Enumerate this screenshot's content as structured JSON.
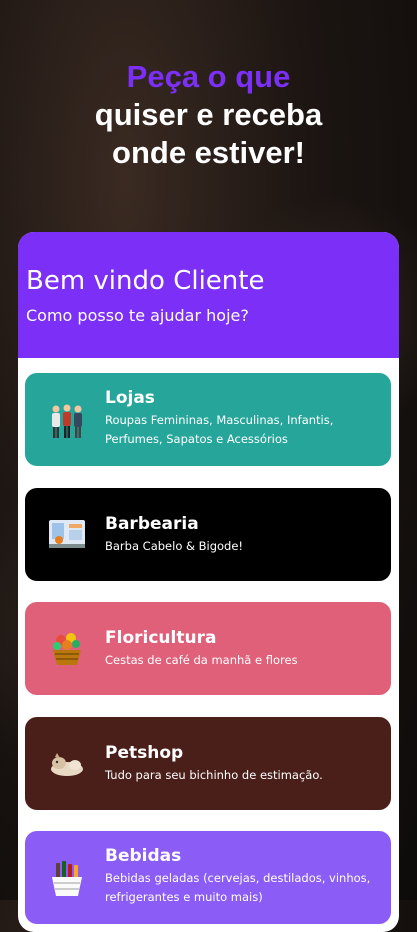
{
  "headline": {
    "accent": "Peça o que",
    "line2": "quiser e receba",
    "line3": "onde estiver!"
  },
  "header": {
    "title": "Bem vindo Cliente",
    "subtitle": "Como posso te ajudar hoje?"
  },
  "categories": [
    {
      "name": "Lojas",
      "desc": "Roupas Femininas, Masculinas, Infantis, Perfumes, Sapatos e Acessórios",
      "color": "#26a69a",
      "icon": "people-shopping-icon"
    },
    {
      "name": "Barbearia",
      "desc": "Barba Cabelo & Bigode!",
      "color": "#000000",
      "icon": "barber-shop-icon"
    },
    {
      "name": "Floricultura",
      "desc": "Cestas de café da manhã e flores",
      "color": "#e0607a",
      "icon": "flower-basket-icon"
    },
    {
      "name": "Petshop",
      "desc": "Tudo para seu bichinho de estimação.",
      "color": "#4a1f1a",
      "icon": "pet-icon"
    },
    {
      "name": "Bebidas",
      "desc": "Bebidas geladas (cervejas, destilados, vinhos, refrigerantes e muito mais)",
      "color": "#8b5cf6",
      "icon": "drinks-basket-icon"
    }
  ],
  "colors": {
    "primary": "#7b2ff7",
    "card_bg": "#ffffff"
  }
}
